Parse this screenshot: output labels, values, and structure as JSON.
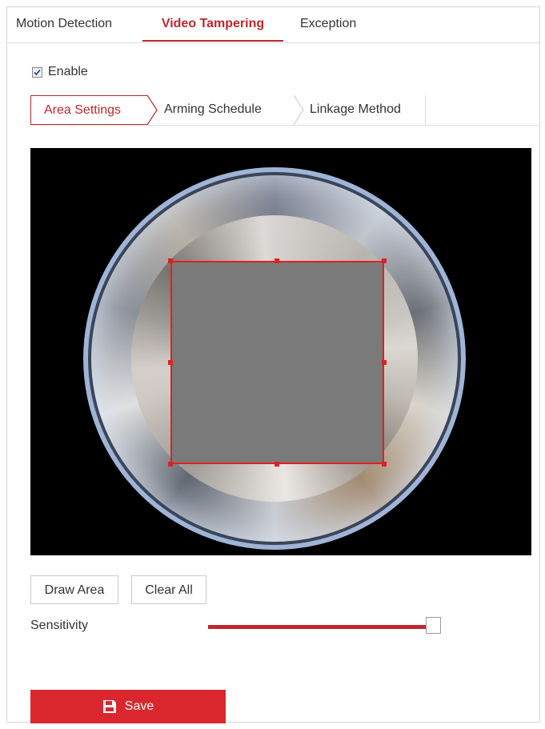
{
  "tabs": {
    "motion_detection": "Motion Detection",
    "video_tampering": "Video Tampering",
    "exception": "Exception"
  },
  "enable": {
    "label": "Enable",
    "checked": true
  },
  "sub_tabs": {
    "area_settings": "Area Settings",
    "arming_schedule": "Arming Schedule",
    "linkage_method": "Linkage Method"
  },
  "buttons": {
    "draw_area": "Draw Area",
    "clear_all": "Clear All",
    "save": "Save"
  },
  "sensitivity": {
    "label": "Sensitivity",
    "value_fraction": 0.97
  },
  "colors": {
    "accent": "#c0272d",
    "save_button": "#d9272d",
    "mask_border": "#e02020",
    "mask_fill": "#7a7a7a"
  },
  "icons": {
    "save": "floppy-disk-icon",
    "checkbox": "checkmark-icon",
    "separator": "chevron-right-icon"
  }
}
